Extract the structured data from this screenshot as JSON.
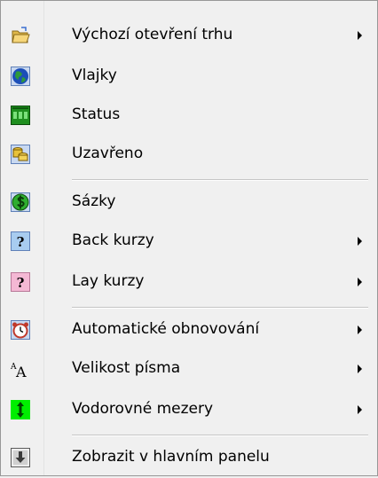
{
  "menu": {
    "items": [
      {
        "label": "Výchozí otevření trhu",
        "icon": "open-folder-icon",
        "submenu": true
      },
      {
        "label": "Vlajky",
        "icon": "globe-icon",
        "submenu": false
      },
      {
        "label": "Status",
        "icon": "status-board-icon",
        "submenu": false
      },
      {
        "label": "Uzavřeno",
        "icon": "coins-icon",
        "submenu": false
      },
      {
        "label": "Sázky",
        "icon": "dollar-icon",
        "submenu": false
      },
      {
        "label": "Back kurzy",
        "icon": "question-icon",
        "submenu": true
      },
      {
        "label": "Lay kurzy",
        "icon": "question-icon",
        "submenu": true
      },
      {
        "label": "Automatické obnovování",
        "icon": "alarm-clock-icon",
        "submenu": true
      },
      {
        "label": "Velikost písma",
        "icon": "font-size-icon",
        "submenu": true
      },
      {
        "label": "Vodorovné mezery",
        "icon": "vertical-spacing-icon",
        "submenu": true
      },
      {
        "label": "Zobrazit v hlavním panelu",
        "icon": "download-arrow-icon",
        "submenu": false
      }
    ],
    "font_size_glyphs": {
      "small": "A",
      "large": "A"
    }
  }
}
